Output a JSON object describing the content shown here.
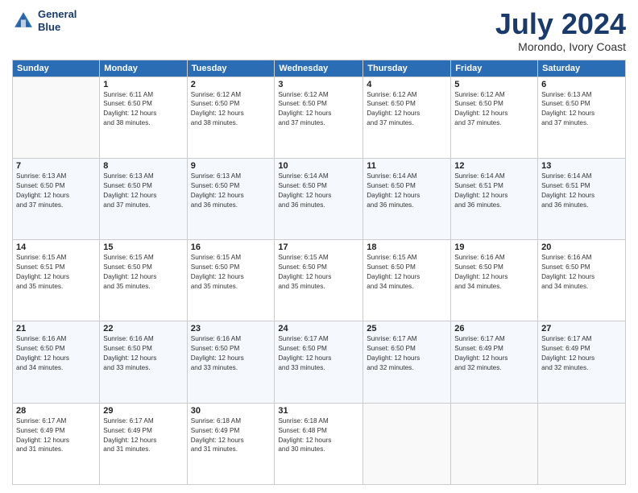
{
  "header": {
    "logo_line1": "General",
    "logo_line2": "Blue",
    "month": "July 2024",
    "location": "Morondo, Ivory Coast"
  },
  "days_of_week": [
    "Sunday",
    "Monday",
    "Tuesday",
    "Wednesday",
    "Thursday",
    "Friday",
    "Saturday"
  ],
  "weeks": [
    [
      {
        "day": "",
        "info": ""
      },
      {
        "day": "1",
        "info": "Sunrise: 6:11 AM\nSunset: 6:50 PM\nDaylight: 12 hours\nand 38 minutes."
      },
      {
        "day": "2",
        "info": "Sunrise: 6:12 AM\nSunset: 6:50 PM\nDaylight: 12 hours\nand 38 minutes."
      },
      {
        "day": "3",
        "info": "Sunrise: 6:12 AM\nSunset: 6:50 PM\nDaylight: 12 hours\nand 37 minutes."
      },
      {
        "day": "4",
        "info": "Sunrise: 6:12 AM\nSunset: 6:50 PM\nDaylight: 12 hours\nand 37 minutes."
      },
      {
        "day": "5",
        "info": "Sunrise: 6:12 AM\nSunset: 6:50 PM\nDaylight: 12 hours\nand 37 minutes."
      },
      {
        "day": "6",
        "info": "Sunrise: 6:13 AM\nSunset: 6:50 PM\nDaylight: 12 hours\nand 37 minutes."
      }
    ],
    [
      {
        "day": "7",
        "info": "Sunrise: 6:13 AM\nSunset: 6:50 PM\nDaylight: 12 hours\nand 37 minutes."
      },
      {
        "day": "8",
        "info": "Sunrise: 6:13 AM\nSunset: 6:50 PM\nDaylight: 12 hours\nand 37 minutes."
      },
      {
        "day": "9",
        "info": "Sunrise: 6:13 AM\nSunset: 6:50 PM\nDaylight: 12 hours\nand 36 minutes."
      },
      {
        "day": "10",
        "info": "Sunrise: 6:14 AM\nSunset: 6:50 PM\nDaylight: 12 hours\nand 36 minutes."
      },
      {
        "day": "11",
        "info": "Sunrise: 6:14 AM\nSunset: 6:50 PM\nDaylight: 12 hours\nand 36 minutes."
      },
      {
        "day": "12",
        "info": "Sunrise: 6:14 AM\nSunset: 6:51 PM\nDaylight: 12 hours\nand 36 minutes."
      },
      {
        "day": "13",
        "info": "Sunrise: 6:14 AM\nSunset: 6:51 PM\nDaylight: 12 hours\nand 36 minutes."
      }
    ],
    [
      {
        "day": "14",
        "info": "Sunrise: 6:15 AM\nSunset: 6:51 PM\nDaylight: 12 hours\nand 35 minutes."
      },
      {
        "day": "15",
        "info": "Sunrise: 6:15 AM\nSunset: 6:50 PM\nDaylight: 12 hours\nand 35 minutes."
      },
      {
        "day": "16",
        "info": "Sunrise: 6:15 AM\nSunset: 6:50 PM\nDaylight: 12 hours\nand 35 minutes."
      },
      {
        "day": "17",
        "info": "Sunrise: 6:15 AM\nSunset: 6:50 PM\nDaylight: 12 hours\nand 35 minutes."
      },
      {
        "day": "18",
        "info": "Sunrise: 6:15 AM\nSunset: 6:50 PM\nDaylight: 12 hours\nand 34 minutes."
      },
      {
        "day": "19",
        "info": "Sunrise: 6:16 AM\nSunset: 6:50 PM\nDaylight: 12 hours\nand 34 minutes."
      },
      {
        "day": "20",
        "info": "Sunrise: 6:16 AM\nSunset: 6:50 PM\nDaylight: 12 hours\nand 34 minutes."
      }
    ],
    [
      {
        "day": "21",
        "info": "Sunrise: 6:16 AM\nSunset: 6:50 PM\nDaylight: 12 hours\nand 34 minutes."
      },
      {
        "day": "22",
        "info": "Sunrise: 6:16 AM\nSunset: 6:50 PM\nDaylight: 12 hours\nand 33 minutes."
      },
      {
        "day": "23",
        "info": "Sunrise: 6:16 AM\nSunset: 6:50 PM\nDaylight: 12 hours\nand 33 minutes."
      },
      {
        "day": "24",
        "info": "Sunrise: 6:17 AM\nSunset: 6:50 PM\nDaylight: 12 hours\nand 33 minutes."
      },
      {
        "day": "25",
        "info": "Sunrise: 6:17 AM\nSunset: 6:50 PM\nDaylight: 12 hours\nand 32 minutes."
      },
      {
        "day": "26",
        "info": "Sunrise: 6:17 AM\nSunset: 6:49 PM\nDaylight: 12 hours\nand 32 minutes."
      },
      {
        "day": "27",
        "info": "Sunrise: 6:17 AM\nSunset: 6:49 PM\nDaylight: 12 hours\nand 32 minutes."
      }
    ],
    [
      {
        "day": "28",
        "info": "Sunrise: 6:17 AM\nSunset: 6:49 PM\nDaylight: 12 hours\nand 31 minutes."
      },
      {
        "day": "29",
        "info": "Sunrise: 6:17 AM\nSunset: 6:49 PM\nDaylight: 12 hours\nand 31 minutes."
      },
      {
        "day": "30",
        "info": "Sunrise: 6:18 AM\nSunset: 6:49 PM\nDaylight: 12 hours\nand 31 minutes."
      },
      {
        "day": "31",
        "info": "Sunrise: 6:18 AM\nSunset: 6:48 PM\nDaylight: 12 hours\nand 30 minutes."
      },
      {
        "day": "",
        "info": ""
      },
      {
        "day": "",
        "info": ""
      },
      {
        "day": "",
        "info": ""
      }
    ]
  ]
}
